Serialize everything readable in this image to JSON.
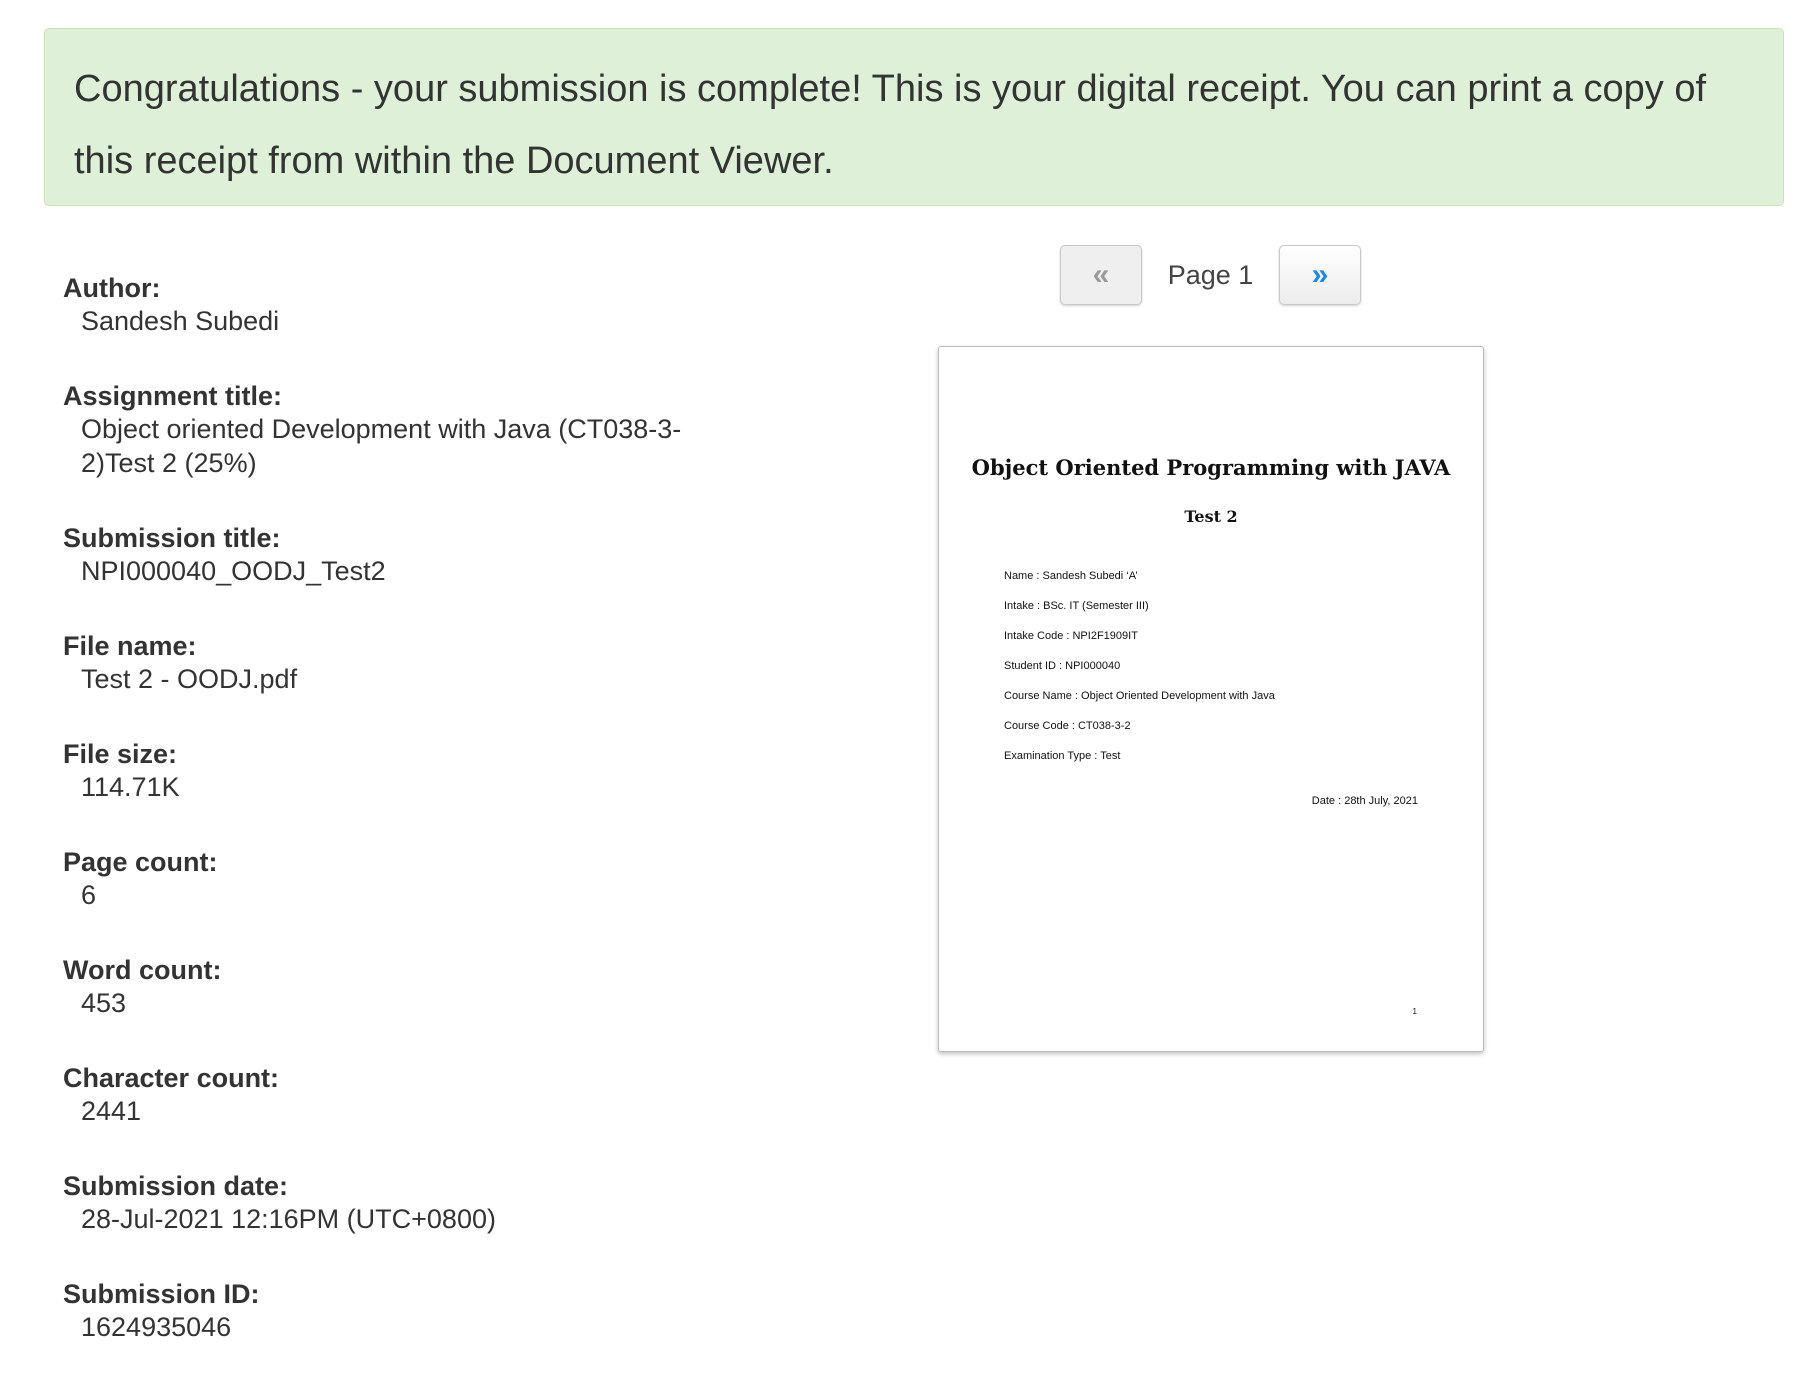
{
  "alert": {
    "message": "Congratulations - your submission is complete! This is your digital receipt. You can print a copy of this receipt from within the Document Viewer."
  },
  "details": [
    {
      "label": "Author:",
      "value": "Sandesh Subedi"
    },
    {
      "label": "Assignment title:",
      "value_lines": [
        "Object oriented Development with Java (CT038-3-",
        "2)Test 2 (25%)"
      ]
    },
    {
      "label": "Submission title:",
      "value": "NPI000040_OODJ_Test2"
    },
    {
      "label": "File name:",
      "value": "Test 2 - OODJ.pdf"
    },
    {
      "label": "File size:",
      "value": "114.71K"
    },
    {
      "label": "Page count:",
      "value": "6"
    },
    {
      "label": "Word count:",
      "value": "453"
    },
    {
      "label": "Character count:",
      "value": "2441"
    },
    {
      "label": "Submission date:",
      "value": "28-Jul-2021 12:16PM (UTC+0800)"
    },
    {
      "label": "Submission ID:",
      "value": "1624935046"
    }
  ],
  "pager": {
    "prev_label": "«",
    "next_label": "»",
    "page_label": "Page 1"
  },
  "document": {
    "title": "Object Oriented Programming with JAVA",
    "subtitle": "Test 2",
    "lines": [
      "Name : Sandesh Subedi ‘A’",
      "Intake : BSc. IT (Semester III)",
      "Intake Code : NPI2F1909IT",
      "Student ID : NPI000040",
      "Course Name : Object Oriented Development with Java",
      "Course Code : CT038-3-2",
      "Examination Type : Test"
    ],
    "date": "Date : 28th July, 2021",
    "page_number": "1"
  },
  "colors": {
    "alert_background": "#dff0d8",
    "next_arrow": "#1e88e5",
    "text": "#333333"
  }
}
